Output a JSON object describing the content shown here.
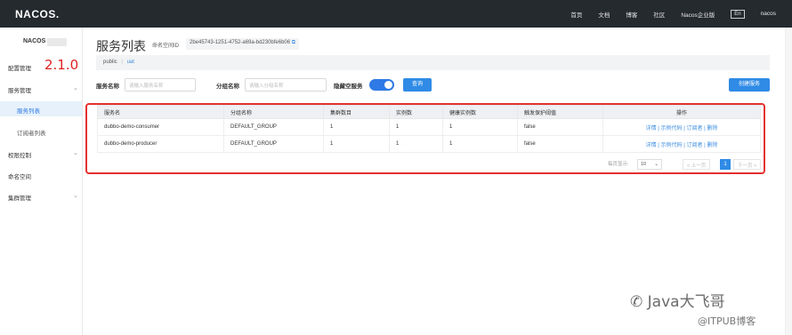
{
  "topbar": {
    "logo": "NACOS.",
    "nav": [
      "首页",
      "文档",
      "博客",
      "社区",
      "Nacos企业版",
      "En",
      "nacos"
    ]
  },
  "sidebar": {
    "title": "NACOS",
    "version_annotation": "2.1.0",
    "items": [
      {
        "label": "配置管理"
      },
      {
        "label": "服务管理"
      },
      {
        "label": "服务列表"
      },
      {
        "label": "订阅者列表"
      },
      {
        "label": "权限控制"
      },
      {
        "label": "命名空间"
      },
      {
        "label": "集群管理"
      }
    ]
  },
  "main": {
    "title": "服务列表",
    "namespace_label": "命名空间ID",
    "namespace_id": "2be45743-1251-4752-a69a-bd230bfe6b06",
    "ns_tabs": {
      "first": "public",
      "sep": "|",
      "current": "uat"
    },
    "search": {
      "service_name_label": "服务名称",
      "service_name_placeholder": "请输入服务名称",
      "group_name_label": "分组名称",
      "group_name_placeholder": "请输入分组名称",
      "hide_empty_label": "隐藏空服务",
      "query_button": "查询",
      "create_button": "创建服务"
    },
    "table": {
      "headers": [
        "服务名",
        "分组名称",
        "集群数目",
        "实例数",
        "健康实例数",
        "触发保护阈值",
        "操作"
      ],
      "rows": [
        {
          "name": "dubbo-demo-consumer",
          "group": "DEFAULT_GROUP",
          "clusters": "1",
          "instances": "1",
          "healthy": "1",
          "threshold": "false"
        },
        {
          "name": "dubbo-demo-producer",
          "group": "DEFAULT_GROUP",
          "clusters": "1",
          "instances": "1",
          "healthy": "1",
          "threshold": "false"
        }
      ],
      "ops": {
        "detail": "详情",
        "sample": "示例代码",
        "subscriber": "订阅者",
        "delete": "删除",
        "sep": "|"
      }
    },
    "pager": {
      "per_page_label": "每页显示:",
      "per_page_value": "10",
      "prev": "< 上一页",
      "current": "1",
      "next": "下一页 >"
    }
  },
  "watermark": {
    "line1": "Java大飞哥",
    "line2": "@ITPUB博客"
  }
}
